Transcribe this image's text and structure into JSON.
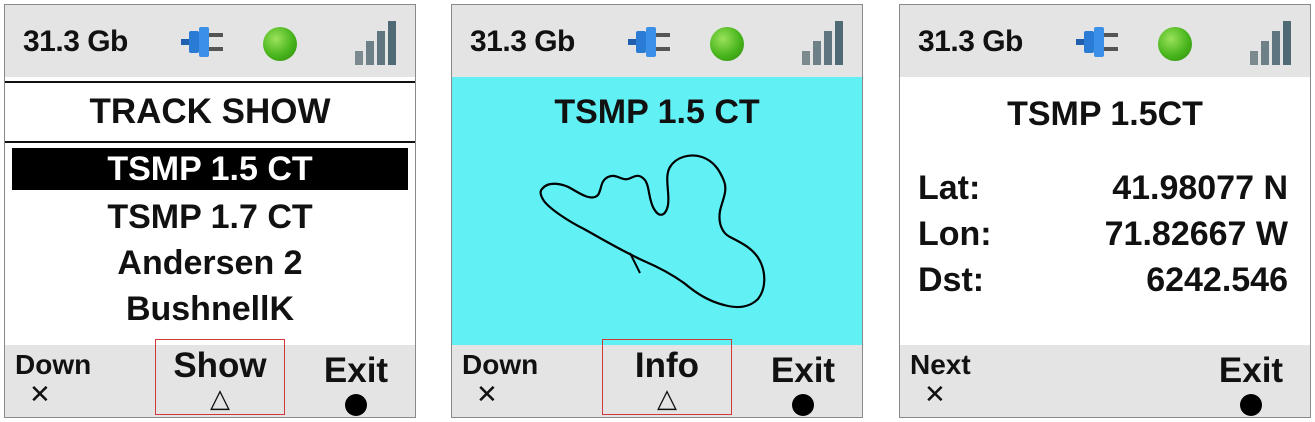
{
  "status": {
    "storage": "31.3 Gb",
    "power_icon": "plug-icon",
    "gps_led_color": "#49b51c",
    "signal_icon": "signal-bars-icon"
  },
  "screen1": {
    "title": "TRACK SHOW",
    "items": [
      {
        "label": "TSMP 1.5 CT",
        "selected": true
      },
      {
        "label": "TSMP 1.7 CT",
        "selected": false
      },
      {
        "label": "Andersen 2",
        "selected": false
      },
      {
        "label": "BushnellK",
        "selected": false
      }
    ],
    "softkeys": {
      "left": "Down",
      "center": "Show",
      "right": "Exit"
    }
  },
  "screen2": {
    "title": "TSMP 1.5 CT",
    "map_background": "#61f1f5",
    "softkeys": {
      "left": "Down",
      "center": "Info",
      "right": "Exit"
    }
  },
  "screen3": {
    "title": "TSMP 1.5CT",
    "rows": [
      {
        "label": "Lat:",
        "value": "41.98077 N"
      },
      {
        "label": "Lon:",
        "value": "71.82667 W"
      },
      {
        "label": "Dst:",
        "value": "6242.546"
      }
    ],
    "softkeys": {
      "left": "Next",
      "right": "Exit"
    }
  },
  "icons": {
    "cross": "✕",
    "triangle": "△"
  }
}
